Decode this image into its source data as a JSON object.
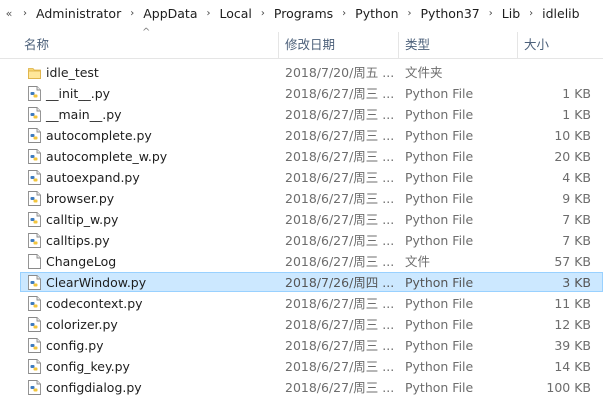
{
  "address": {
    "more_glyph": "«",
    "separator": "›",
    "crumbs": [
      "Administrator",
      "AppData",
      "Local",
      "Programs",
      "Python",
      "Python37",
      "Lib",
      "idlelib"
    ]
  },
  "columns": {
    "name": "名称",
    "date": "修改日期",
    "type": "类型",
    "size": "大小",
    "sort_glyph": "^"
  },
  "selected_index": 10,
  "files": [
    {
      "name": "idle_test",
      "date": "2018/7/20/周五 ...",
      "type": "文件夹",
      "size": "",
      "icon": "folder-icon"
    },
    {
      "name": "__init__.py",
      "date": "2018/6/27/周三 ...",
      "type": "Python File",
      "size": "1 KB",
      "icon": "python-file-icon"
    },
    {
      "name": "__main__.py",
      "date": "2018/6/27/周三 ...",
      "type": "Python File",
      "size": "1 KB",
      "icon": "python-file-icon"
    },
    {
      "name": "autocomplete.py",
      "date": "2018/6/27/周三 ...",
      "type": "Python File",
      "size": "10 KB",
      "icon": "python-file-icon"
    },
    {
      "name": "autocomplete_w.py",
      "date": "2018/6/27/周三 ...",
      "type": "Python File",
      "size": "20 KB",
      "icon": "python-file-icon"
    },
    {
      "name": "autoexpand.py",
      "date": "2018/6/27/周三 ...",
      "type": "Python File",
      "size": "4 KB",
      "icon": "python-file-icon"
    },
    {
      "name": "browser.py",
      "date": "2018/6/27/周三 ...",
      "type": "Python File",
      "size": "9 KB",
      "icon": "python-file-icon"
    },
    {
      "name": "calltip_w.py",
      "date": "2018/6/27/周三 ...",
      "type": "Python File",
      "size": "7 KB",
      "icon": "python-file-icon"
    },
    {
      "name": "calltips.py",
      "date": "2018/6/27/周三 ...",
      "type": "Python File",
      "size": "7 KB",
      "icon": "python-file-icon"
    },
    {
      "name": "ChangeLog",
      "date": "2018/6/27/周三 ...",
      "type": "文件",
      "size": "57 KB",
      "icon": "file-icon"
    },
    {
      "name": "ClearWindow.py",
      "date": "2018/7/26/周四 ...",
      "type": "Python File",
      "size": "3 KB",
      "icon": "python-file-icon"
    },
    {
      "name": "codecontext.py",
      "date": "2018/6/27/周三 ...",
      "type": "Python File",
      "size": "11 KB",
      "icon": "python-file-icon"
    },
    {
      "name": "colorizer.py",
      "date": "2018/6/27/周三 ...",
      "type": "Python File",
      "size": "12 KB",
      "icon": "python-file-icon"
    },
    {
      "name": "config.py",
      "date": "2018/6/27/周三 ...",
      "type": "Python File",
      "size": "39 KB",
      "icon": "python-file-icon"
    },
    {
      "name": "config_key.py",
      "date": "2018/6/27/周三 ...",
      "type": "Python File",
      "size": "14 KB",
      "icon": "python-file-icon"
    },
    {
      "name": "configdialog.py",
      "date": "2018/6/27/周三 ...",
      "type": "Python File",
      "size": "100 KB",
      "icon": "python-file-icon"
    }
  ],
  "colors": {
    "selection_fill": "#cce8ff",
    "selection_border": "#99d1ff",
    "header_text": "#4c607a",
    "folder": "#f8d775"
  }
}
